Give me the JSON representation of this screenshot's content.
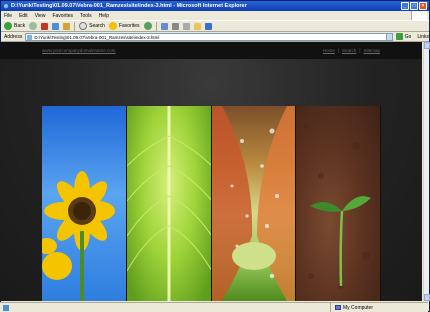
{
  "window": {
    "title": "D:\\Yurik\\Testing\\01.09.07\\Vebra-001_Ramzes\\site\\index-3.html - Microsoft Internet Explorer",
    "buttons": {
      "minimize": "_",
      "maximize": "□",
      "close": "×"
    }
  },
  "menu": {
    "items": [
      "File",
      "Edit",
      "View",
      "Favorites",
      "Tools",
      "Help"
    ]
  },
  "toolbar": {
    "back_label": "Back",
    "search_label": "Search",
    "favorites_label": "Favorites"
  },
  "address": {
    "label": "Address",
    "value": "D:\\Yurik\\Testing\\01.09.07\\Vebra-001_Ramzes\\site\\index-3.html",
    "go_label": "Go",
    "links_label": "Links"
  },
  "site": {
    "url": "www.yourcompanydomainname.com",
    "nav": [
      "Home",
      "Search",
      "Sitemap"
    ],
    "nav_sep": "|"
  },
  "status": {
    "left": "",
    "zone": "My Computer"
  }
}
